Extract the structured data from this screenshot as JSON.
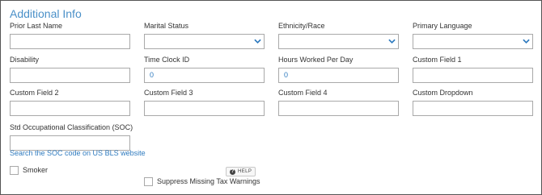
{
  "section": {
    "title": "Additional Info"
  },
  "fields": {
    "prior_last_name": {
      "label": "Prior Last Name",
      "value": ""
    },
    "marital_status": {
      "label": "Marital Status",
      "selected": ""
    },
    "ethnicity_race": {
      "label": "Ethnicity/Race",
      "selected": ""
    },
    "primary_language": {
      "label": "Primary Language",
      "selected": ""
    },
    "disability": {
      "label": "Disability",
      "value": ""
    },
    "time_clock_id": {
      "label": "Time Clock ID",
      "value": "0"
    },
    "hours_worked_per_day": {
      "label": "Hours Worked Per Day",
      "value": "0"
    },
    "custom_field_1": {
      "label": "Custom Field 1",
      "value": ""
    },
    "custom_field_2": {
      "label": "Custom Field 2",
      "value": ""
    },
    "custom_field_3": {
      "label": "Custom Field 3",
      "value": ""
    },
    "custom_field_4": {
      "label": "Custom Field 4",
      "value": ""
    },
    "custom_dropdown": {
      "label": "Custom Dropdown",
      "value": ""
    },
    "soc": {
      "label": "Std Occupational Classification (SOC)",
      "value": ""
    }
  },
  "soc_link": {
    "text": "Search the SOC code on US BLS website"
  },
  "smoker": {
    "label": "Smoker",
    "checked": false
  },
  "help": {
    "label": "HELP",
    "icon": "?"
  },
  "suppress": {
    "label": "Suppress Missing Tax Warnings",
    "checked": false
  },
  "colors": {
    "accent": "#4a90c8",
    "link": "#2f7bbf",
    "border": "#a9a9a9"
  },
  "icons": {
    "dropdown": "chevron-down-icon",
    "help": "question-circle-icon"
  }
}
